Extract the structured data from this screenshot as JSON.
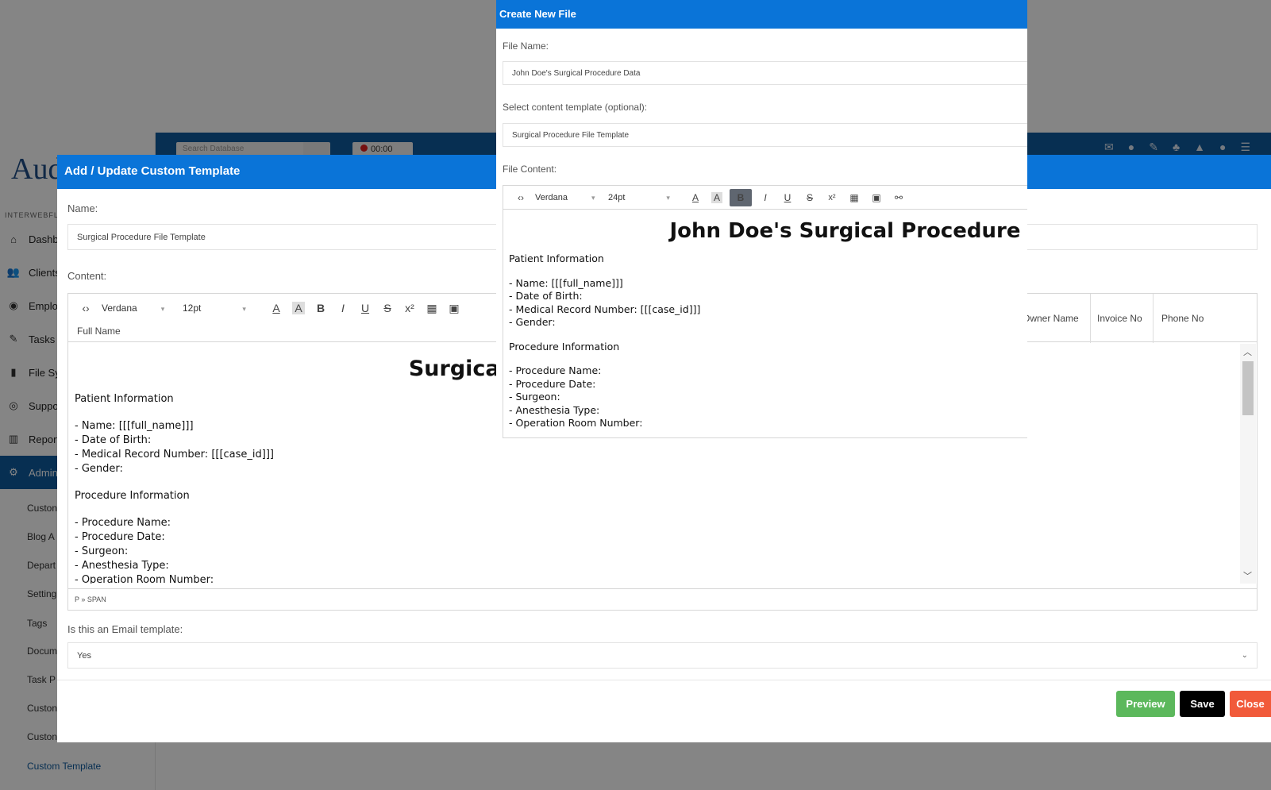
{
  "app": {
    "logo": "Aud",
    "org": "INTERWEBFL",
    "nav": [
      {
        "label": "Dashb",
        "icon": "home-icon"
      },
      {
        "label": "Clients",
        "icon": "users-icon"
      },
      {
        "label": "Emplo",
        "icon": "user-circle-icon"
      },
      {
        "label": "Tasks",
        "icon": "pencil-icon"
      },
      {
        "label": "File Sy",
        "icon": "file-icon"
      },
      {
        "label": "Suppo",
        "icon": "lifebuoy-icon"
      },
      {
        "label": "Report",
        "icon": "bar-chart-icon"
      },
      {
        "label": "Admin",
        "icon": "gears-icon"
      }
    ],
    "admin_sub": [
      "Custon",
      "Blog A",
      "Depart",
      "Setting",
      "Tags",
      "Docum",
      "Task P",
      "Custon",
      "Custon",
      "Custom Template"
    ],
    "search_placeholder": "Search Database",
    "timer": "00:00"
  },
  "template_modal": {
    "title": "Add / Update Custom Template",
    "name_label": "Name:",
    "name_value": "Surgical Procedure File Template",
    "content_label": "Content:",
    "toolbar": {
      "font": "Verdana",
      "size": "12pt"
    },
    "merge_fields": [
      "Full Name",
      "Owner Name",
      "Invoice No",
      "Phone No"
    ],
    "merge_field_partial": "I",
    "doc": {
      "heading": "Surgical Procedure File",
      "section1": "Patient Information",
      "lines1": [
        "- Name: [[[full_name]]]",
        "- Date of Birth:",
        "- Medical Record Number: [[[case_id]]]",
        "- Gender:"
      ],
      "section2": "Procedure Information",
      "lines2": [
        "- Procedure Name:",
        "- Procedure Date:",
        "- Surgeon:",
        "- Anesthesia Type:",
        "- Operation Room Number:"
      ]
    },
    "statusbar": "P » SPAN",
    "email_label": "Is this an Email template:",
    "email_value": "Yes",
    "buttons": {
      "preview": "Preview",
      "save": "Save",
      "close": "Close"
    },
    "colors": {
      "header": "#0a74d8",
      "preview": "#5cb85c",
      "save": "#000000",
      "close": "#f15a3a"
    }
  },
  "create_file": {
    "title": "Create New File",
    "file_name_label": "File Name:",
    "file_name_value": "John Doe's Surgical Procedure Data",
    "template_label": "Select content template (optional):",
    "template_value": "Surgical Procedure File Template",
    "content_label": "File Content:",
    "toolbar": {
      "font": "Verdana",
      "size": "24pt"
    },
    "doc": {
      "heading": "John Doe's Surgical Procedure",
      "section1": "Patient Information",
      "lines1": [
        "- Name: [[[full_name]]]",
        "- Date of Birth:",
        "- Medical Record Number: [[[case_id]]]",
        "- Gender:"
      ],
      "section2": "Procedure Information",
      "lines2": [
        "- Procedure Name:",
        "- Procedure Date:",
        "- Surgeon:",
        "- Anesthesia Type:",
        "- Operation Room Number:"
      ]
    }
  }
}
